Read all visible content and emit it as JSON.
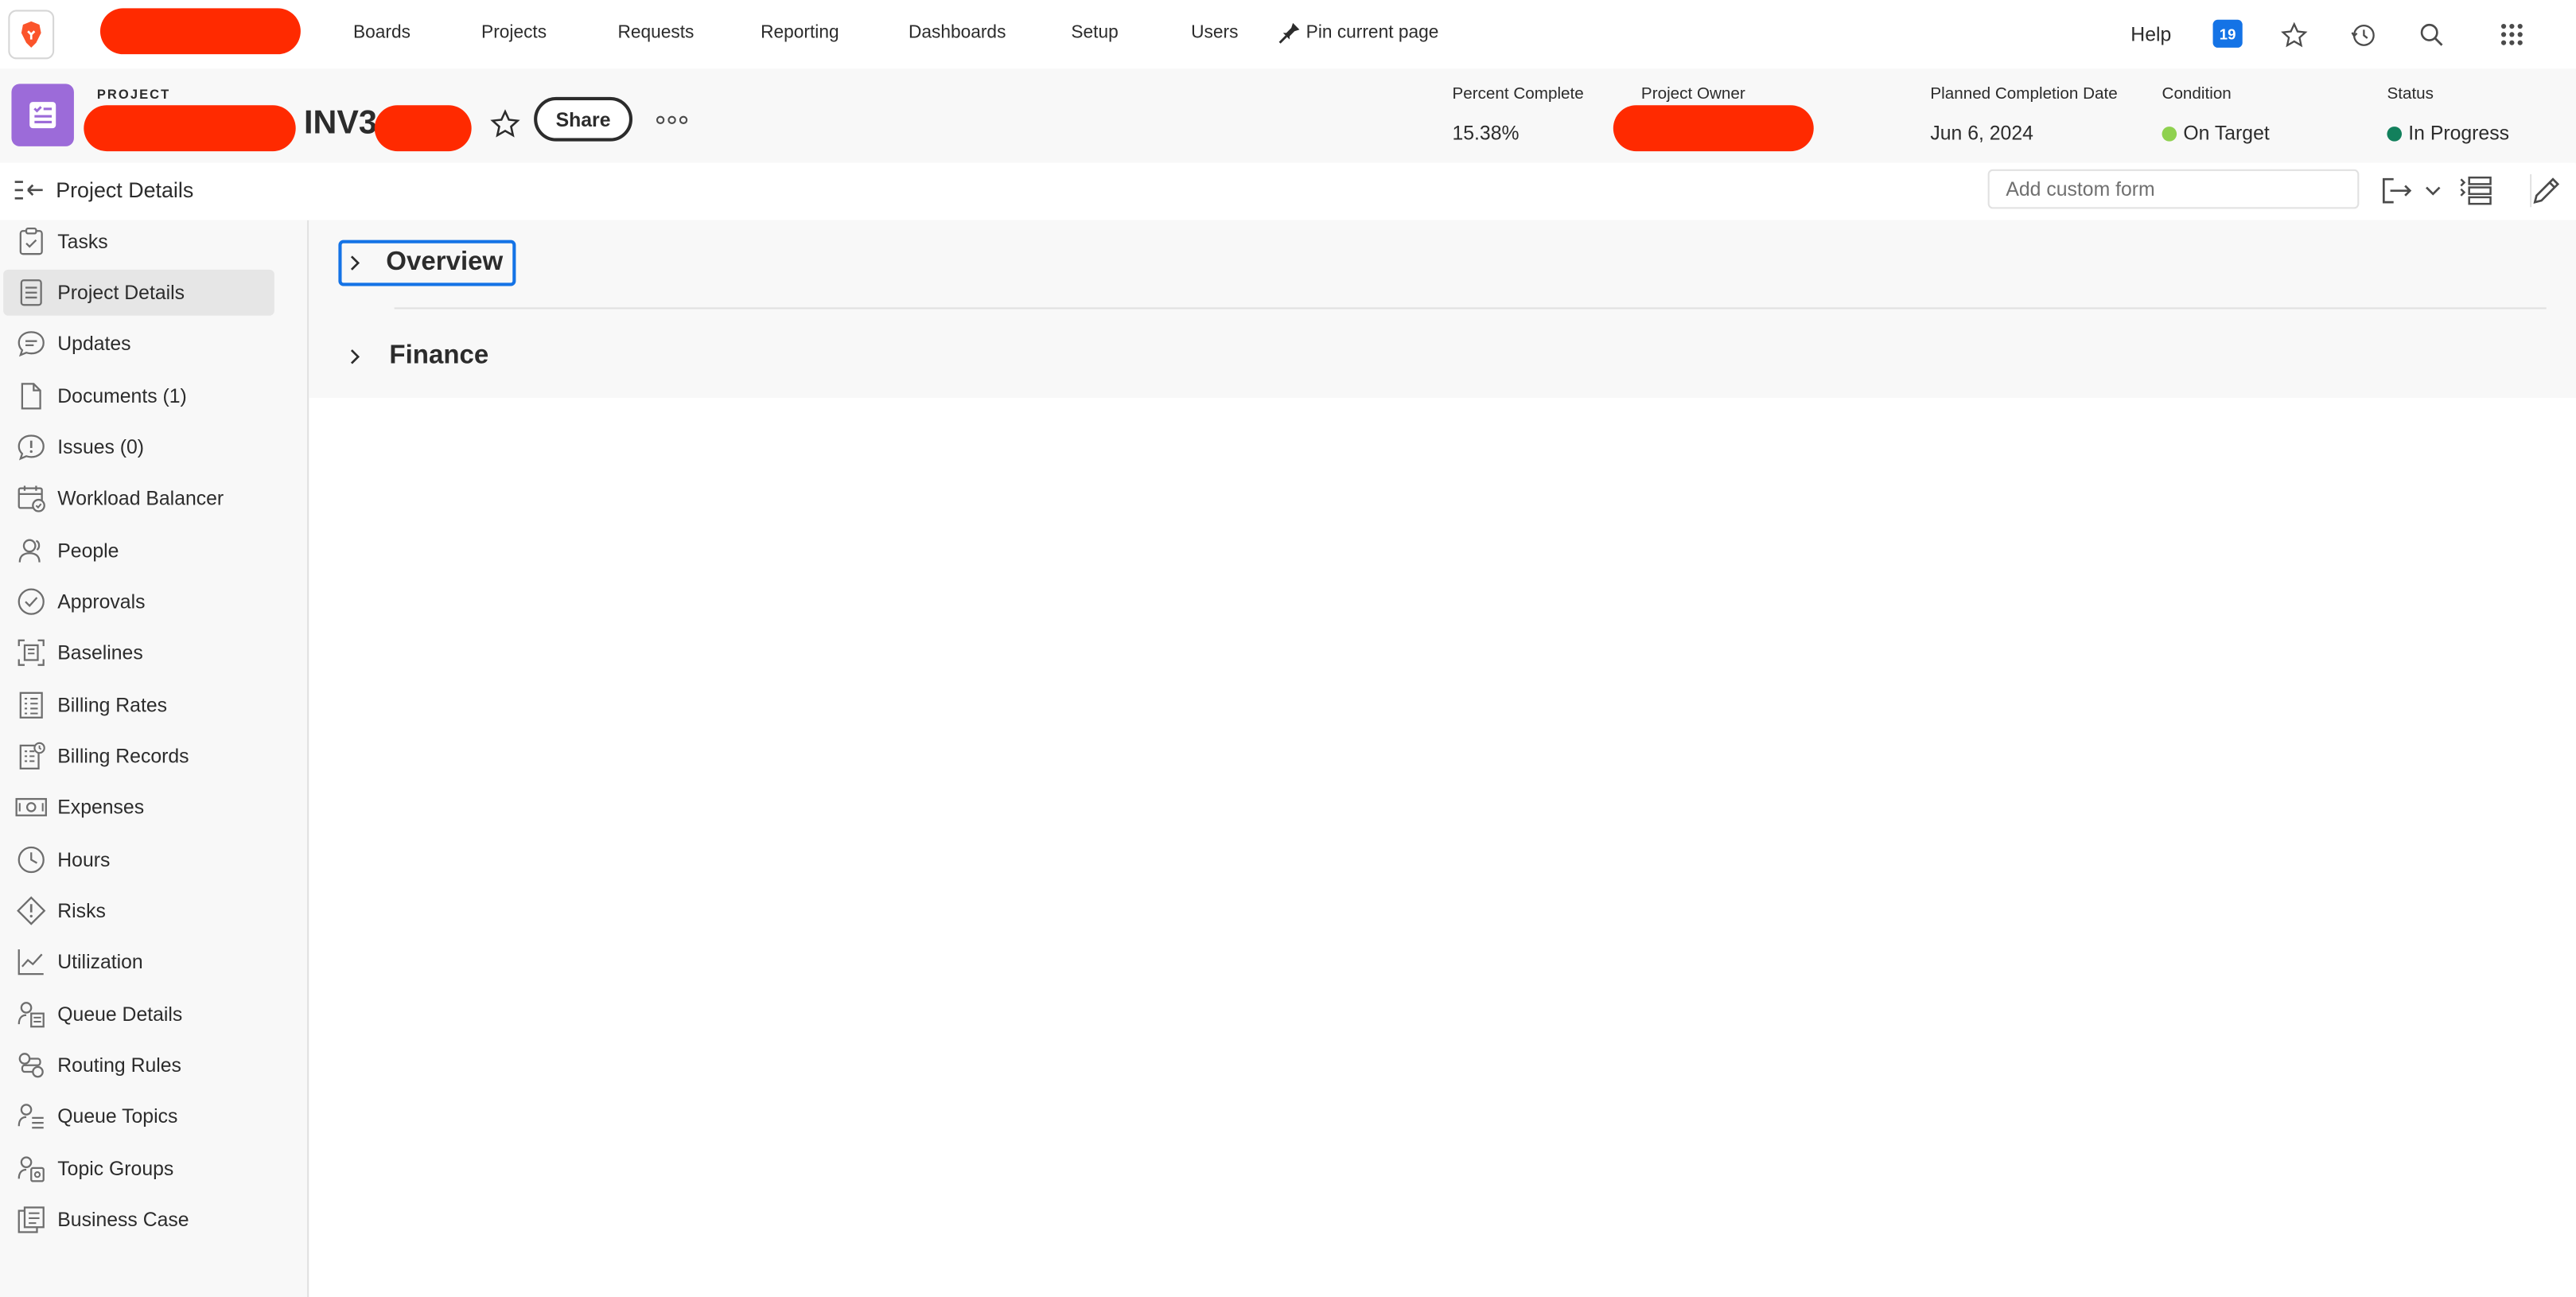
{
  "topnav": {
    "links": [
      "Boards",
      "Projects",
      "Requests",
      "Reporting",
      "Dashboards",
      "Setup",
      "Users"
    ],
    "pin_label": "Pin current page",
    "help_label": "Help",
    "notifications_count": "19"
  },
  "project": {
    "label": "PROJECT",
    "name_visible": "INV3",
    "share_label": "Share",
    "meta": {
      "percent_label": "Percent Complete",
      "percent_value": "15.38%",
      "owner_label": "Project Owner",
      "planned_label": "Planned Completion Date",
      "planned_value": "Jun 6, 2024",
      "condition_label": "Condition",
      "condition_value": "On Target",
      "status_label": "Status",
      "status_value": "In Progress"
    },
    "colors": {
      "condition_dot": "#8fd14f",
      "status_dot": "#12805c",
      "accent": "#1473e6",
      "project_icon": "#9c6bd9"
    }
  },
  "subheader": {
    "title": "Project Details",
    "custom_form_placeholder": "Add custom form"
  },
  "sidebar": {
    "items": [
      {
        "label": "Tasks",
        "icon": "clipboard-check-icon"
      },
      {
        "label": "Project Details",
        "icon": "document-icon",
        "active": true
      },
      {
        "label": "Updates",
        "icon": "chat-bubble-icon"
      },
      {
        "label": "Documents (1)",
        "icon": "file-icon"
      },
      {
        "label": "Issues (0)",
        "icon": "issue-bubble-icon"
      },
      {
        "label": "Workload Balancer",
        "icon": "calendar-check-icon"
      },
      {
        "label": "People",
        "icon": "people-icon"
      },
      {
        "label": "Approvals",
        "icon": "check-circle-icon"
      },
      {
        "label": "Baselines",
        "icon": "baseline-icon"
      },
      {
        "label": "Billing Rates",
        "icon": "billing-rates-icon"
      },
      {
        "label": "Billing Records",
        "icon": "billing-records-icon"
      },
      {
        "label": "Expenses",
        "icon": "money-icon"
      },
      {
        "label": "Hours",
        "icon": "clock-icon"
      },
      {
        "label": "Risks",
        "icon": "alert-diamond-icon"
      },
      {
        "label": "Utilization",
        "icon": "chart-line-icon"
      },
      {
        "label": "Queue Details",
        "icon": "queue-details-icon"
      },
      {
        "label": "Routing Rules",
        "icon": "routing-icon"
      },
      {
        "label": "Queue Topics",
        "icon": "queue-topics-icon"
      },
      {
        "label": "Topic Groups",
        "icon": "topic-groups-icon"
      },
      {
        "label": "Business Case",
        "icon": "business-case-icon"
      }
    ]
  },
  "main": {
    "sections": [
      {
        "title": "Overview"
      },
      {
        "title": "Finance"
      }
    ]
  }
}
